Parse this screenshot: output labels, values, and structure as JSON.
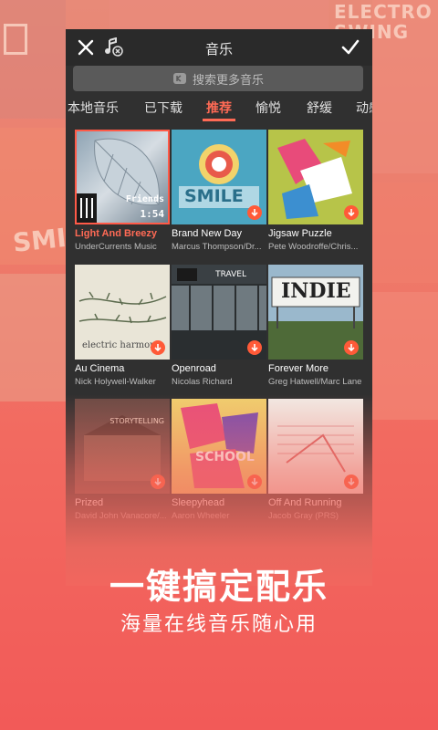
{
  "header": {
    "title": "音乐",
    "close_icon": "close-icon",
    "music_note_icon": "music-note-remove-icon",
    "confirm_icon": "checkmark-icon"
  },
  "search": {
    "placeholder": "搜索更多音乐",
    "icon": "search-icon"
  },
  "tabs": [
    {
      "label": "本地音乐",
      "active": false
    },
    {
      "label": "已下载",
      "active": false
    },
    {
      "label": "推荐",
      "active": true
    },
    {
      "label": "愉悦",
      "active": false
    },
    {
      "label": "舒缓",
      "active": false
    },
    {
      "label": "动感",
      "active": false
    }
  ],
  "tracks": [
    {
      "title": "Light And Breezy",
      "artist": "UnderCurrents Music",
      "duration": "1:54",
      "selected": true
    },
    {
      "title": "Brand New Day",
      "artist": "Marcus Thompson/Dr...",
      "download": true
    },
    {
      "title": "Jigsaw Puzzle",
      "artist": "Pete Woodroffe/Chris...",
      "download": true
    },
    {
      "title": "Au Cinema",
      "artist": "Nick Holywell-Walker",
      "download": true
    },
    {
      "title": "Openroad",
      "artist": "Nicolas Richard",
      "download": true
    },
    {
      "title": "Forever More",
      "artist": "Greg Hatwell/Marc Lane",
      "download": true
    },
    {
      "title": "Prized",
      "artist": "David John Vanacore/...",
      "download": true
    },
    {
      "title": "Sleepyhead",
      "artist": "Aaron Wheeler",
      "download": true
    },
    {
      "title": "Off And Running",
      "artist": "Jacob Gray (PRS)",
      "download": true
    }
  ],
  "art_labels": {
    "light_breezy": "Friends",
    "smile": "SMILE",
    "electric_harmony": "electric harmony",
    "travel": "TRAVEL",
    "indie": "INDIE",
    "school": "SCHOOL",
    "storytelling": "STORYTELLING"
  },
  "promo": {
    "headline": "一键搞定配乐",
    "subline": "海量在线音乐随心用"
  },
  "background": {
    "electro": "ELECTRO",
    "swing": "SWING",
    "smile": "SMILE"
  },
  "colors": {
    "accent": "#ff6a55",
    "download": "#ff5a38",
    "phone_bg": "#303030",
    "promo_bg": "#f2665e"
  }
}
